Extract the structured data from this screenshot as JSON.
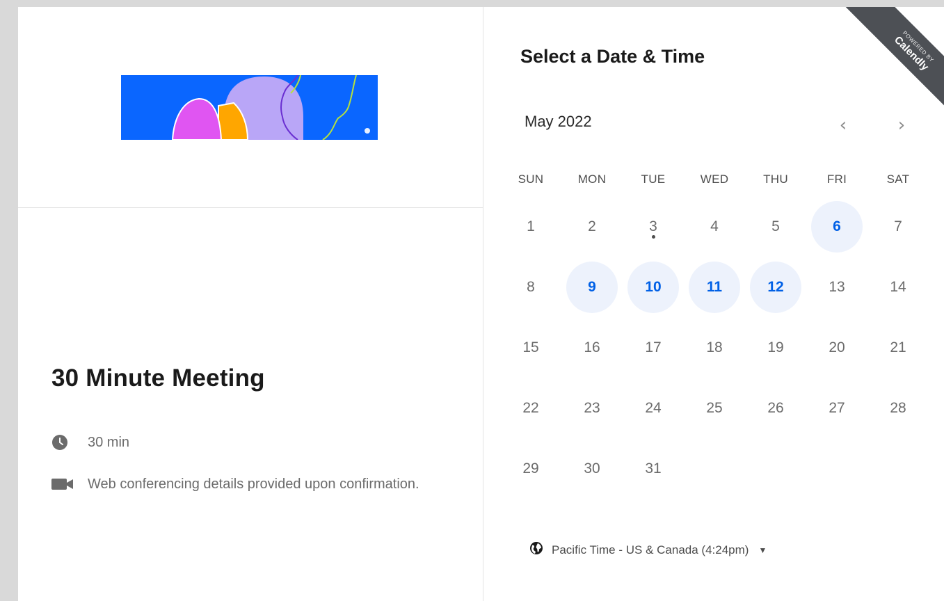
{
  "event": {
    "title": "30 Minute Meeting",
    "duration": "30 min",
    "conferencing": "Web conferencing details provided upon confirmation."
  },
  "scheduler": {
    "heading": "Select a Date & Time",
    "month_label": "May 2022",
    "prev_symbol": "‹",
    "next_symbol": "›",
    "weekdays": [
      "SUN",
      "MON",
      "TUE",
      "WED",
      "THU",
      "FRI",
      "SAT"
    ],
    "weeks": [
      [
        {
          "d": "1"
        },
        {
          "d": "2"
        },
        {
          "d": "3",
          "today": true
        },
        {
          "d": "4"
        },
        {
          "d": "5"
        },
        {
          "d": "6",
          "available": true
        },
        {
          "d": "7"
        }
      ],
      [
        {
          "d": "8"
        },
        {
          "d": "9",
          "available": true
        },
        {
          "d": "10",
          "available": true
        },
        {
          "d": "11",
          "available": true
        },
        {
          "d": "12",
          "available": true
        },
        {
          "d": "13"
        },
        {
          "d": "14"
        }
      ],
      [
        {
          "d": "15"
        },
        {
          "d": "16"
        },
        {
          "d": "17"
        },
        {
          "d": "18"
        },
        {
          "d": "19"
        },
        {
          "d": "20"
        },
        {
          "d": "21"
        }
      ],
      [
        {
          "d": "22"
        },
        {
          "d": "23"
        },
        {
          "d": "24"
        },
        {
          "d": "25"
        },
        {
          "d": "26"
        },
        {
          "d": "27"
        },
        {
          "d": "28"
        }
      ],
      [
        {
          "d": "29"
        },
        {
          "d": "30"
        },
        {
          "d": "31"
        },
        {
          "d": ""
        },
        {
          "d": ""
        },
        {
          "d": ""
        },
        {
          "d": ""
        }
      ]
    ],
    "timezone": "Pacific Time - US & Canada (4:24pm)"
  },
  "ribbon": {
    "powered_by": "POWERED BY",
    "brand": "Calendly"
  },
  "icons": {
    "duration": "clock-icon",
    "conferencing": "video-camera-icon",
    "timezone": "globe-icon",
    "timezone_caret": "caret-down-icon"
  },
  "colors": {
    "accent": "#0060e6",
    "available_bg": "#edf2fc",
    "ribbon": "#4d5055",
    "logo_blue": "#0a66ff",
    "logo_lavender": "#b9a6f7",
    "logo_magenta": "#e055f2",
    "logo_orange": "#ffa600",
    "logo_green": "#b6e23c"
  }
}
